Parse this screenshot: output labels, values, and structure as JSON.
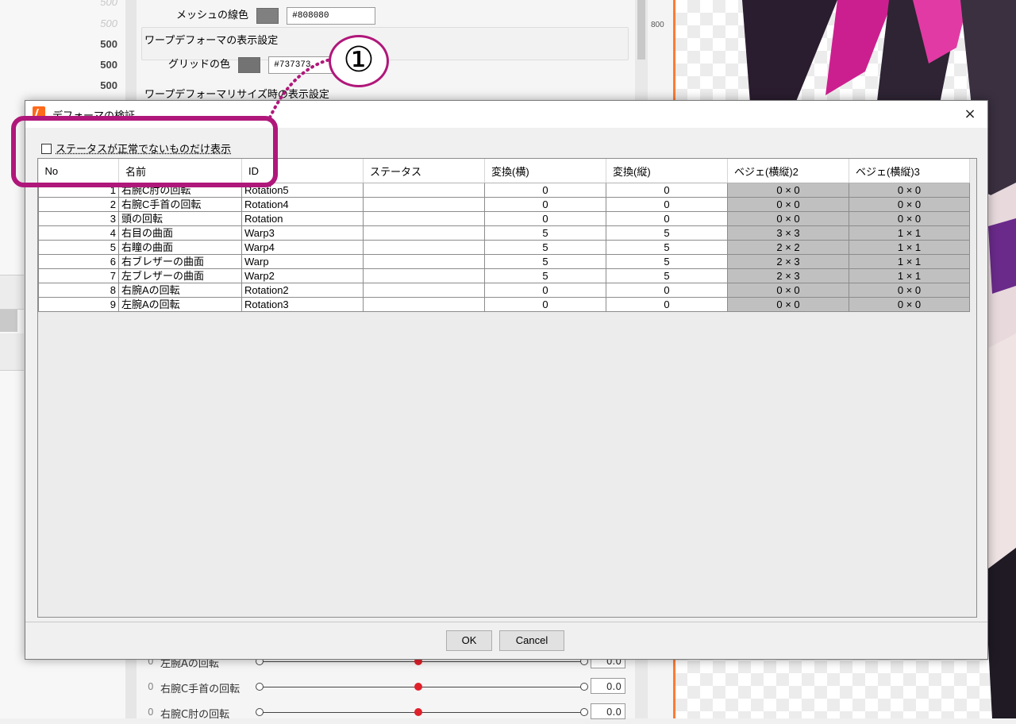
{
  "background": {
    "left_numbers": [
      "500",
      "500",
      "500",
      "500",
      "500"
    ],
    "panel": {
      "mesh_line_color_label": "メッシュの線色",
      "mesh_line_color_hex": "#808080",
      "warp_display_group": "ワープデフォーマの表示設定",
      "grid_color_label": "グリッドの色",
      "grid_color_hex": "#737373",
      "warp_resize_group": "ワープデフォーマリサイズ時の表示設定"
    },
    "ruler_label": "800",
    "sliders": [
      {
        "zero": "0",
        "label": "左腕Aの回転",
        "value": "0.0"
      },
      {
        "zero": "0",
        "label": "右腕C手首の回転",
        "value": "0.0"
      },
      {
        "zero": "0",
        "label": "右腕C肘の回転",
        "value": "0.0"
      }
    ],
    "colors": {
      "swatch_mesh": "#808080",
      "swatch_grid": "#737373"
    }
  },
  "dialog": {
    "title": "デフォーマの検証",
    "close_symbol": "×",
    "filter_checkbox_label": "ステータスが正常でないものだけ表示",
    "filter_checked": false,
    "columns": [
      "No",
      "名前",
      "ID",
      "ステータス",
      "変換(横)",
      "変換(縦)",
      "ベジェ(横縦)2",
      "ベジェ(横縦)3"
    ],
    "rows": [
      [
        "1",
        "右腕C肘の回転",
        "Rotation5",
        "",
        "0",
        "0",
        "0 × 0",
        "0 × 0"
      ],
      [
        "2",
        "右腕C手首の回転",
        "Rotation4",
        "",
        "0",
        "0",
        "0 × 0",
        "0 × 0"
      ],
      [
        "3",
        "頭の回転",
        "Rotation",
        "",
        "0",
        "0",
        "0 × 0",
        "0 × 0"
      ],
      [
        "4",
        "右目の曲面",
        "Warp3",
        "",
        "5",
        "5",
        "3 × 3",
        "1 × 1"
      ],
      [
        "5",
        "右瞳の曲面",
        "Warp4",
        "",
        "5",
        "5",
        "2 × 2",
        "1 × 1"
      ],
      [
        "6",
        "右ブレザーの曲面",
        "Warp",
        "",
        "5",
        "5",
        "2 × 3",
        "1 × 1"
      ],
      [
        "7",
        "左ブレザーの曲面",
        "Warp2",
        "",
        "5",
        "5",
        "2 × 3",
        "1 × 1"
      ],
      [
        "8",
        "右腕Aの回転",
        "Rotation2",
        "",
        "0",
        "0",
        "0 × 0",
        "0 × 0"
      ],
      [
        "9",
        "左腕Aの回転",
        "Rotation3",
        "",
        "0",
        "0",
        "0 × 0",
        "0 × 0"
      ]
    ],
    "ok_label": "OK",
    "cancel_label": "Cancel"
  },
  "annotation": {
    "badge": "①",
    "color": "#b0177a"
  }
}
